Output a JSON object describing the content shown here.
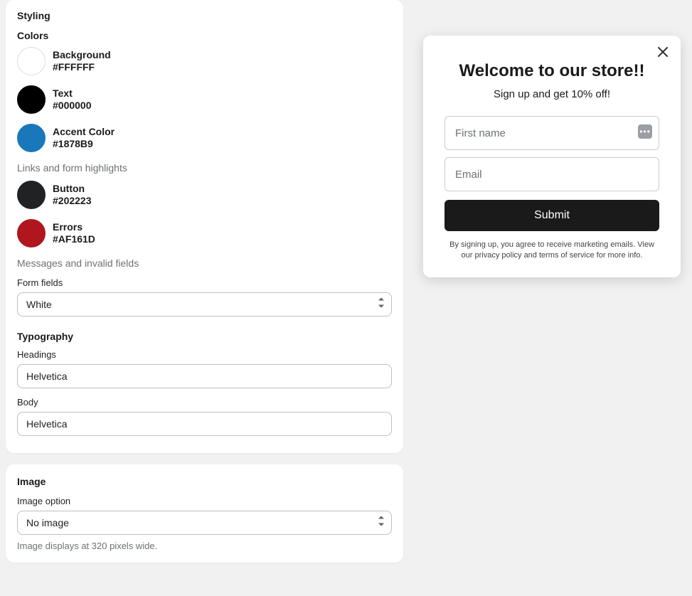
{
  "styling": {
    "title": "Styling",
    "colors_title": "Colors",
    "colors": [
      {
        "name": "Background",
        "hex": "#FFFFFF",
        "swatch_class": "swatch-bg"
      },
      {
        "name": "Text",
        "hex": "#000000",
        "swatch_class": "swatch-text"
      },
      {
        "name": "Accent Color",
        "hex": "#1878B9",
        "swatch_class": "swatch-accent"
      }
    ],
    "links_note": "Links and form highlights",
    "colors2": [
      {
        "name": "Button",
        "hex": "#202223",
        "swatch_class": "swatch-button"
      },
      {
        "name": "Errors",
        "hex": "#AF161D",
        "swatch_class": "swatch-errors"
      }
    ],
    "errors_note": "Messages and invalid fields",
    "form_fields": {
      "label": "Form fields",
      "value": "White"
    },
    "typography": {
      "title": "Typography",
      "headings": {
        "label": "Headings",
        "value": "Helvetica"
      },
      "body": {
        "label": "Body",
        "value": "Helvetica"
      }
    }
  },
  "image": {
    "title": "Image",
    "option": {
      "label": "Image option",
      "value": "No image"
    },
    "help": "Image displays at 320 pixels wide."
  },
  "preview": {
    "heading": "Welcome to our store!!",
    "subtitle": "Sign up and get 10% off!",
    "first_name_placeholder": "First name",
    "email_placeholder": "Email",
    "submit_label": "Submit",
    "legal": "By signing up, you agree to receive marketing emails. View our privacy policy and terms of service for more info."
  }
}
